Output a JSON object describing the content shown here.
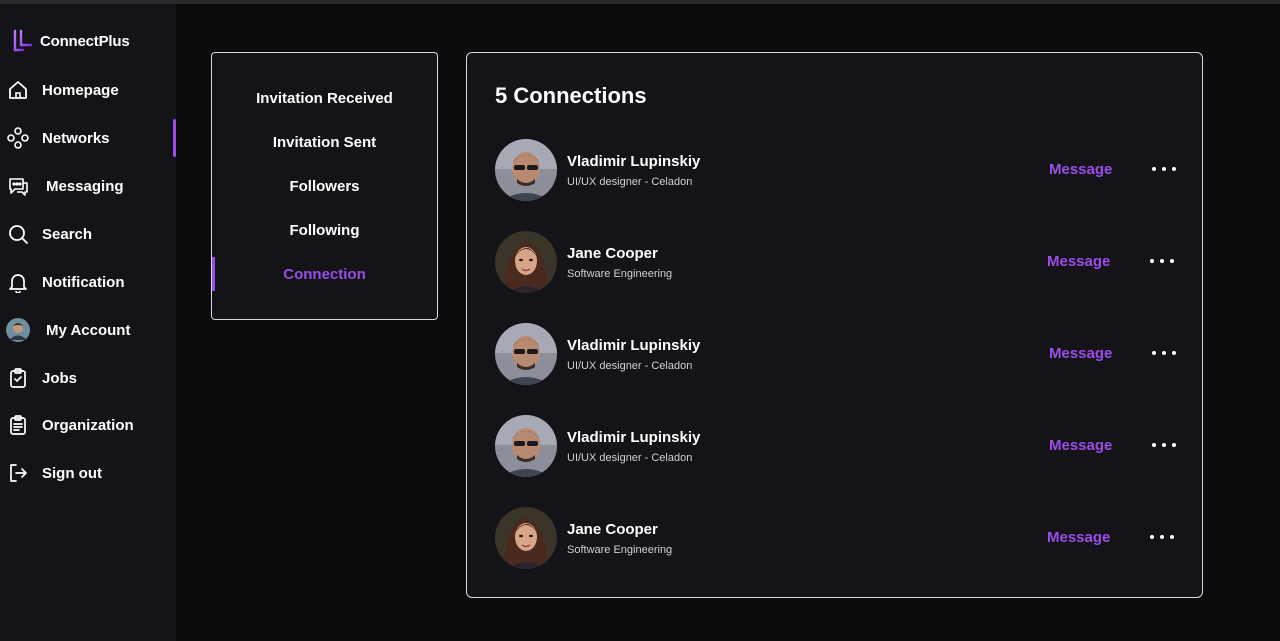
{
  "app": {
    "name": "ConnectPlus",
    "accent_color": "#9b4dea"
  },
  "sidebar": {
    "items": [
      {
        "label": "Homepage",
        "icon": "home-icon"
      },
      {
        "label": "Networks",
        "icon": "network-icon",
        "active": true
      },
      {
        "label": "Messaging",
        "icon": "chat-bubble-icon"
      },
      {
        "label": "Search",
        "icon": "search-icon"
      },
      {
        "label": "Notification",
        "icon": "bell-icon"
      },
      {
        "label": "My Account",
        "icon": "avatar-icon"
      },
      {
        "label": "Jobs",
        "icon": "clipboard-check-icon"
      },
      {
        "label": "Organization",
        "icon": "clipboard-list-icon"
      },
      {
        "label": "Sign out",
        "icon": "sign-out-icon"
      }
    ]
  },
  "network_tabs": [
    {
      "label": "Invitation Received"
    },
    {
      "label": "Invitation Sent"
    },
    {
      "label": "Followers"
    },
    {
      "label": "Following"
    },
    {
      "label": "Connection",
      "active": true
    }
  ],
  "connections": {
    "title": "5 Connections",
    "message_label": "Message",
    "list": [
      {
        "name": "Vladimir Lupinskiy",
        "role": "UI/UX designer - Celadon",
        "avatar": "man-avatar"
      },
      {
        "name": "Jane Cooper",
        "role": "Software Engineering",
        "avatar": "woman-avatar"
      },
      {
        "name": "Vladimir Lupinskiy",
        "role": "UI/UX designer - Celadon",
        "avatar": "man-avatar"
      },
      {
        "name": "Vladimir Lupinskiy",
        "role": "UI/UX designer - Celadon",
        "avatar": "man-avatar"
      },
      {
        "name": "Jane Cooper",
        "role": "Software Engineering",
        "avatar": "woman-avatar"
      }
    ]
  }
}
